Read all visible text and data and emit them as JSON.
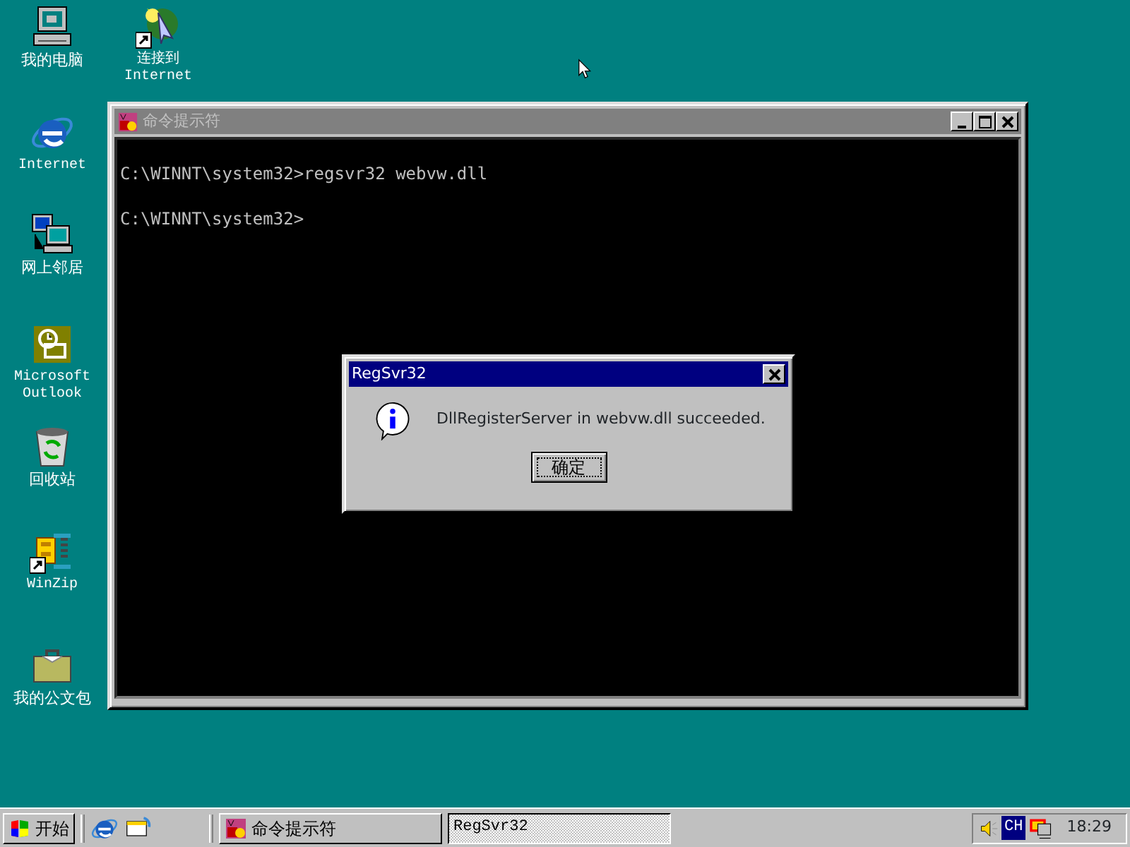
{
  "desktop_icons": [
    {
      "kind": "computer",
      "label": "我的电脑"
    },
    {
      "kind": "connect",
      "label": "连接到 Internet"
    },
    {
      "kind": "browser",
      "label": "Internet"
    },
    {
      "kind": "network",
      "label": "网上邻居"
    },
    {
      "kind": "outlook",
      "label": "Microsoft Outlook"
    },
    {
      "kind": "recycle",
      "label": "回收站"
    },
    {
      "kind": "winzip",
      "label": "WinZip"
    },
    {
      "kind": "briefcase",
      "label": "我的公文包"
    }
  ],
  "console_window": {
    "title": "命令提示符",
    "active": false,
    "lines": [
      "C:\\WINNT\\system32>regsvr32 webvw.dll",
      "C:\\WINNT\\system32>"
    ]
  },
  "dialog": {
    "title": "RegSvr32",
    "active": true,
    "message": "DllRegisterServer in webvw.dll succeeded.",
    "button": "确定"
  },
  "taskbar": {
    "start": "开始",
    "quick_launch": [
      {
        "kind": "browser"
      },
      {
        "kind": "desktop"
      }
    ],
    "tasks": [
      {
        "label": "命令提示符",
        "selected": false,
        "kind": "console"
      },
      {
        "label": "RegSvr32",
        "selected": true,
        "kind": "plain"
      }
    ],
    "input_indicator": "CH",
    "clock": "18:29"
  }
}
